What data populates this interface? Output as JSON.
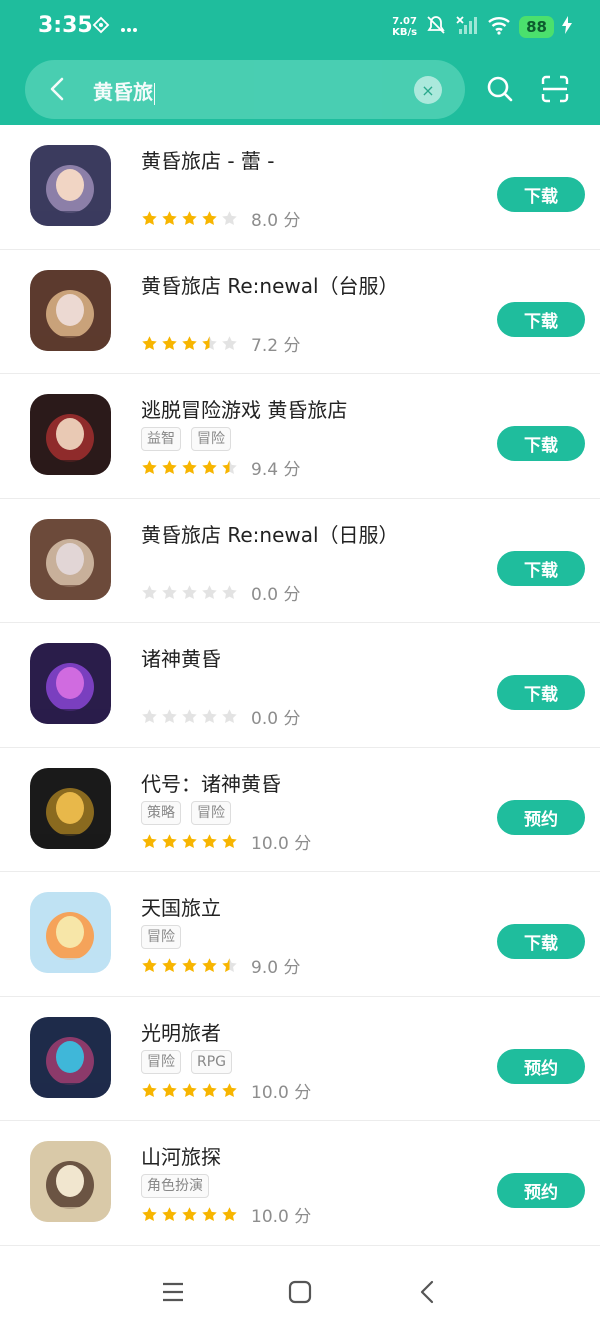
{
  "status_bar": {
    "time": "3:35",
    "net_speed_value": "7.07",
    "net_speed_unit": "KB/s",
    "battery": "88"
  },
  "search": {
    "query": "黄昏旅"
  },
  "colors": {
    "accent": "#1fbd9d",
    "star_filled": "#f7b500",
    "star_empty": "#e3e3e3"
  },
  "results": [
    {
      "title": "黄昏旅店 - 蕾 -",
      "tags": [],
      "stars": 4,
      "score": "8.0 分",
      "action": "下载"
    },
    {
      "title": "黄昏旅店 Re:newal（台服）",
      "tags": [],
      "stars": 3.5,
      "score": "7.2 分",
      "action": "下载"
    },
    {
      "title": "逃脱冒险游戏 黄昏旅店",
      "tags": [
        "益智",
        "冒险"
      ],
      "stars": 4.5,
      "score": "9.4 分",
      "action": "下载"
    },
    {
      "title": "黄昏旅店 Re:newal（日服）",
      "tags": [],
      "stars": 0,
      "score": "0.0 分",
      "action": "下载"
    },
    {
      "title": "诸神黄昏",
      "tags": [],
      "stars": 0,
      "score": "0.0 分",
      "action": "下载"
    },
    {
      "title": "代号：诸神黄昏",
      "tags": [
        "策略",
        "冒险"
      ],
      "stars": 5,
      "score": "10.0 分",
      "action": "预约"
    },
    {
      "title": "天国旅立",
      "tags": [
        "冒险"
      ],
      "stars": 4.5,
      "score": "9.0 分",
      "action": "下载"
    },
    {
      "title": "光明旅者",
      "tags": [
        "冒险",
        "RPG"
      ],
      "stars": 5,
      "score": "10.0 分",
      "action": "预约"
    },
    {
      "title": "山河旅探",
      "tags": [
        "角色扮演"
      ],
      "stars": 5,
      "score": "10.0 分",
      "action": "预约"
    }
  ]
}
